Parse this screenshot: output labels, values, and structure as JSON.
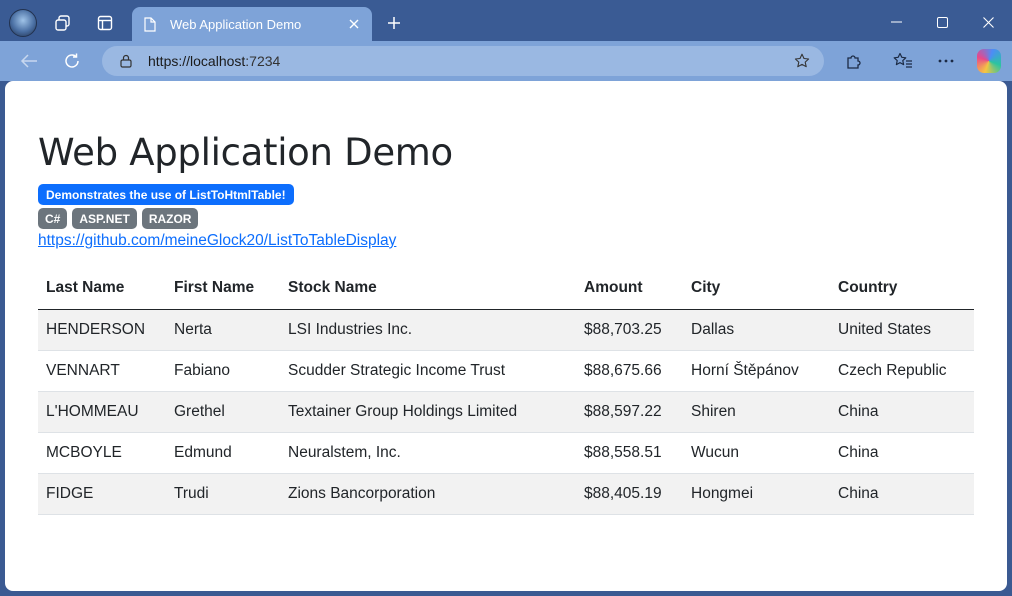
{
  "browser": {
    "tab_title": "Web Application Demo",
    "url_host": "https://localhost",
    "url_port": ":7234"
  },
  "page": {
    "heading": "Web Application Demo",
    "subtitle_badge": "Demonstrates the use of ListToHtmlTable!",
    "tags": [
      "C#",
      "ASP.NET",
      "RAZOR"
    ],
    "link": "https://github.com/meineGlock20/ListToTableDisplay"
  },
  "table": {
    "headers": [
      "Last Name",
      "First Name",
      "Stock Name",
      "Amount",
      "City",
      "Country"
    ],
    "rows": [
      [
        "HENDERSON",
        "Nerta",
        "LSI Industries Inc.",
        "$88,703.25",
        "Dallas",
        "United States"
      ],
      [
        "VENNART",
        "Fabiano",
        "Scudder Strategic Income Trust",
        "$88,675.66",
        "Horní Štěpánov",
        "Czech Republic"
      ],
      [
        "L'HOMMEAU",
        "Grethel",
        "Textainer Group Holdings Limited",
        "$88,597.22",
        "Shiren",
        "China"
      ],
      [
        "MCBOYLE",
        "Edmund",
        "Neuralstem, Inc.",
        "$88,558.51",
        "Wucun",
        "China"
      ],
      [
        "FIDGE",
        "Trudi",
        "Zions Bancorporation",
        "$88,405.19",
        "Hongmei",
        "China"
      ]
    ]
  },
  "colors": {
    "primary_badge": "#0d6efd",
    "secondary_badge": "#6c757d",
    "link": "#0d6efd",
    "stripe": "#f2f2f2"
  }
}
